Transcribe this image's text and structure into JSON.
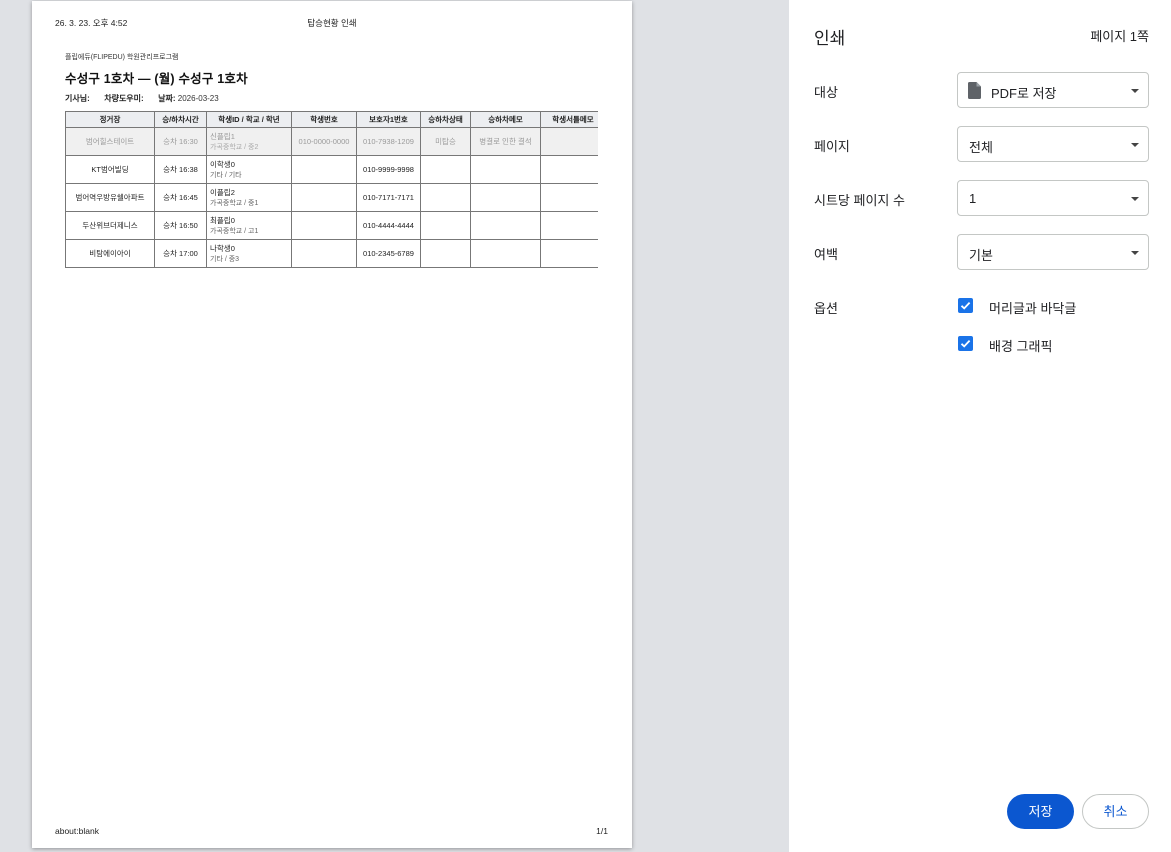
{
  "preview": {
    "header_date": "26. 3. 23. 오후 4:52",
    "header_title": "탑승현황 인쇄",
    "footer_url": "about:blank",
    "footer_page": "1/1",
    "org_name": "플립에듀(FLIPEDU) 학원관리프로그램",
    "route_title": "수성구 1호차 — (월) 수성구 1호차",
    "meta": {
      "driver_label": "기사님:",
      "driver_value": "",
      "helper_label": "차량도우미:",
      "helper_value": "",
      "date_label": "날짜:",
      "date_value": "2026-03-23"
    },
    "table": {
      "headers": [
        "정거장",
        "승/하차시간",
        "학생ID / 학교 / 학년",
        "학생번호",
        "보호자1번호",
        "승하차상태",
        "승하차메모",
        "학생서틀메모"
      ],
      "rows": [
        {
          "stop": "범어힐스테이트",
          "time": "승차 16:30",
          "student": "신플립1",
          "school": "가곡중학교 / 중2",
          "phone": "010-0000-0000",
          "guardian": "010-7938-1209",
          "status": "미탑승",
          "memo": "병결로 인한 결석",
          "note": ""
        },
        {
          "stop": "KT범어빌딩",
          "time": "승차 16:38",
          "student": "이학생0",
          "school": "기타 / 기타",
          "phone": "",
          "guardian": "010-9999-9998",
          "status": "",
          "memo": "",
          "note": ""
        },
        {
          "stop": "범어역우방유쉘아파트",
          "time": "승차 16:45",
          "student": "이플립2",
          "school": "가곡중학교 / 중1",
          "phone": "",
          "guardian": "010-7171-7171",
          "status": "",
          "memo": "",
          "note": ""
        },
        {
          "stop": "두산위브더제니스",
          "time": "승차 16:50",
          "student": "최플립0",
          "school": "가곡중학교 / 고1",
          "phone": "",
          "guardian": "010-4444-4444",
          "status": "",
          "memo": "",
          "note": ""
        },
        {
          "stop": "비탐에이아이",
          "time": "승차 17:00",
          "student": "나학생0",
          "school": "기타 / 중3",
          "phone": "",
          "guardian": "010-2345-6789",
          "status": "",
          "memo": "",
          "note": ""
        }
      ]
    }
  },
  "panel": {
    "title": "인쇄",
    "page_count": "페이지 1쪽",
    "destination_label": "대상",
    "destination_value": "PDF로 저장",
    "pages_label": "페이지",
    "pages_value": "전체",
    "pages_per_sheet_label": "시트당 페이지 수",
    "pages_per_sheet_value": "1",
    "margins_label": "여백",
    "margins_value": "기본",
    "options_label": "옵션",
    "option_headers_footers": "머리글과 바닥글",
    "option_background": "배경 그래픽",
    "save_label": "저장",
    "cancel_label": "취소"
  },
  "colors": {
    "accent": "#0b57d0",
    "checkbox": "#1a73e8",
    "preview_bg": "#dfe1e5"
  },
  "icons": [
    "document-icon",
    "chevron-down-icon",
    "checkmark-icon"
  ]
}
